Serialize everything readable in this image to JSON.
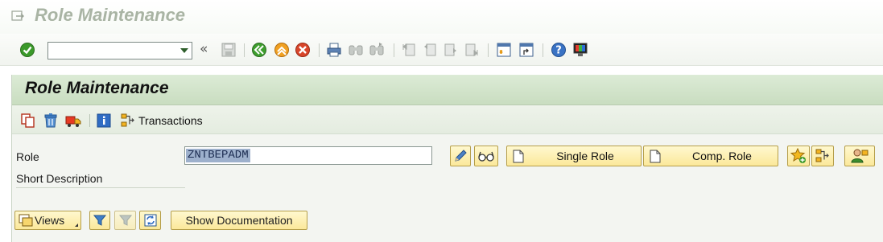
{
  "window": {
    "title": "Role Maintenance"
  },
  "system_toolbar": {
    "command_field": {
      "value": "",
      "placeholder": ""
    },
    "collapse_glyph": "«",
    "icons": [
      "enter-icon",
      "save-icon",
      "back-icon",
      "exit-icon",
      "cancel-icon",
      "print-icon",
      "find-icon",
      "find-next-icon",
      "first-page-icon",
      "previous-page-icon",
      "next-page-icon",
      "last-page-icon",
      "create-session-icon",
      "shortcut-icon",
      "help-icon",
      "customize-layout-icon"
    ]
  },
  "screen": {
    "title": "Role Maintenance"
  },
  "app_toolbar": {
    "icons": [
      "copy-role-icon",
      "delete-role-icon",
      "transport-role-icon",
      "information-icon"
    ],
    "transactions_label": "Transactions"
  },
  "form": {
    "role_label": "Role",
    "role_value": "ZNTBEPADM",
    "short_description_label": "Short Description",
    "short_description_value": ""
  },
  "buttons": {
    "change_icon": "pencil-icon",
    "display_icon": "glasses-icon",
    "single_role": "Single Role",
    "composite_role": "Comp. Role",
    "favorites_icon": "star-add-icon",
    "transactions_icon": "transactions-icon",
    "user_assignment_icon": "user-assignment-icon",
    "views": "Views",
    "filter_icon": "filter-icon",
    "reset_filter_icon": "reset-filter-icon",
    "refresh_icon": "refresh-icon",
    "show_documentation": "Show Documentation"
  },
  "colors": {
    "title_green": "#a9b4a4",
    "header_green": "#cfe2c7",
    "button_yellow": "#fbe89a",
    "selection_blue": "#9db0cc"
  }
}
